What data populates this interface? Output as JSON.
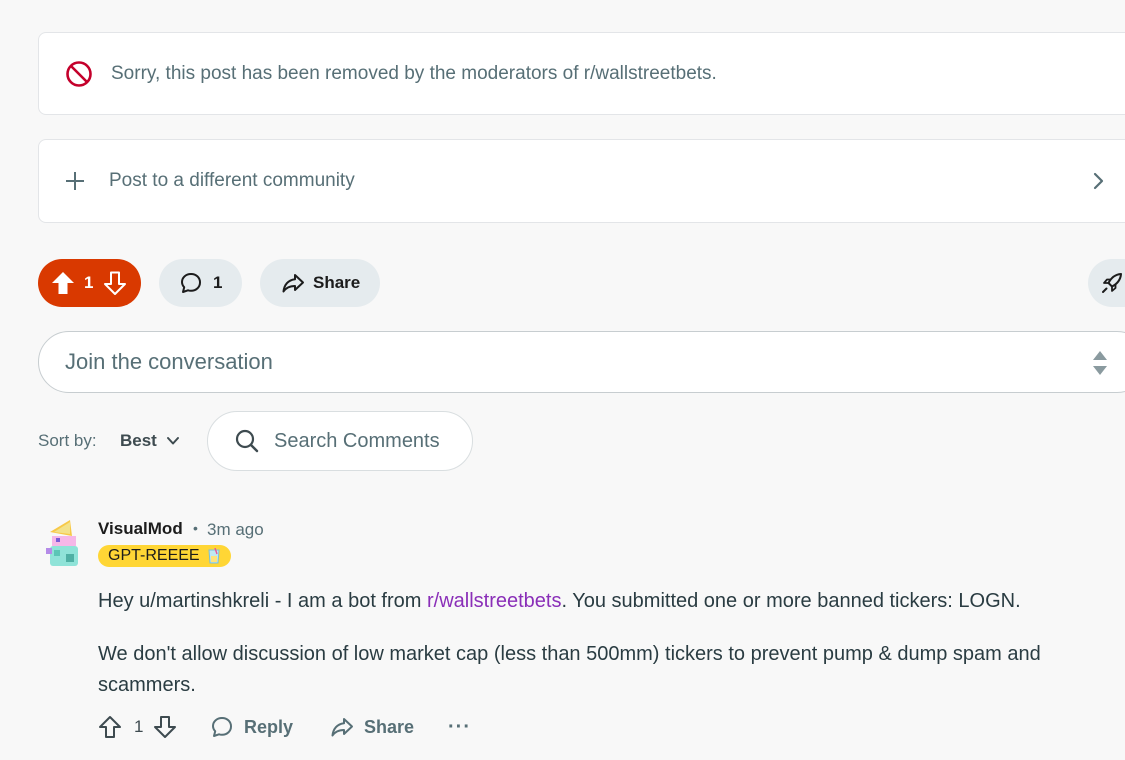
{
  "removed_notice": {
    "text": "Sorry, this post has been removed by the moderators of r/wallstreetbets."
  },
  "crosspost": {
    "label": "Post to a different community"
  },
  "actions_bar": {
    "vote_count": "1",
    "comment_count": "1",
    "share_label": "Share"
  },
  "composer": {
    "placeholder": "Join the conversation"
  },
  "sort": {
    "label": "Sort by:",
    "value": "Best"
  },
  "search": {
    "placeholder": "Search Comments"
  },
  "comment": {
    "author": "VisualMod",
    "separator": "•",
    "time": "3m ago",
    "flair": "GPT-REEEE",
    "paragraph1_pre": "Hey u/martinshkreli - I am a bot from ",
    "paragraph1_link": "r/wallstreetbets",
    "paragraph1_post": ". You submitted one or more banned tickers: LOGN.",
    "paragraph2": "We don't allow discussion of low market cap (less than 500mm) tickers to prevent pump & dump spam and scammers.",
    "vote_count": "1",
    "reply_label": "Reply",
    "share_label": "Share",
    "more_label": "···"
  },
  "colors": {
    "upvote_active": "#d93900",
    "removed_icon": "#c4002b",
    "link": "#8a2fb8",
    "flair_bg": "#ffd635"
  },
  "icons": [
    "ban-icon",
    "plus-icon",
    "chevron-right-icon",
    "upvote-icon",
    "downvote-icon",
    "comment-icon",
    "share-icon",
    "award-icon",
    "resize-icon",
    "chevron-down-icon",
    "search-icon",
    "avatar",
    "flair-emoji-icon",
    "more-icon"
  ]
}
